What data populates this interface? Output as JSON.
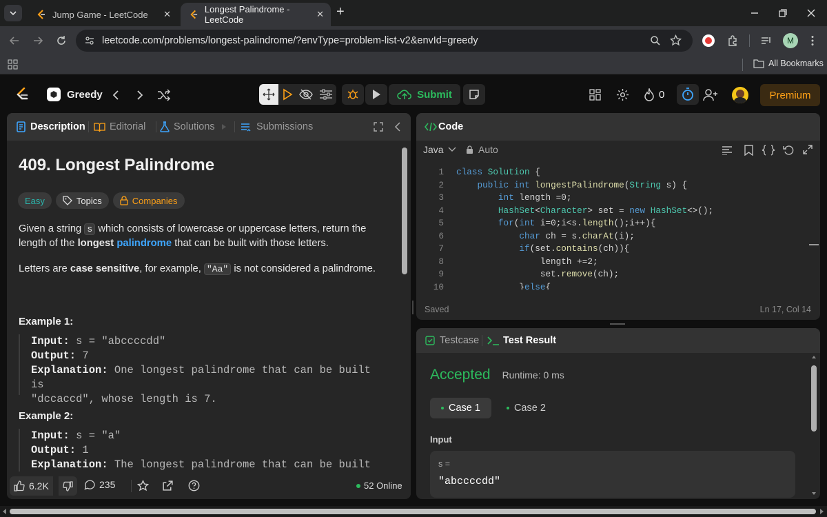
{
  "browser": {
    "tabs": [
      {
        "title": "Jump Game - LeetCode"
      },
      {
        "title": "Longest Palindrome - LeetCode"
      }
    ],
    "url": "leetcode.com/problems/longest-palindrome/?envType=problem-list-v2&envId=greedy",
    "profile_initial": "M",
    "bookmarks_label": "All Bookmarks"
  },
  "nav": {
    "list_name": "Greedy",
    "submit_label": "Submit",
    "streak_count": "0",
    "premium_label": "Premium"
  },
  "left_panel": {
    "tabs": [
      "Description",
      "Editorial",
      "Solutions",
      "Submissions"
    ],
    "problem_title": "409. Longest Palindrome",
    "difficulty": "Easy",
    "topics_label": "Topics",
    "companies_label": "Companies",
    "desc": {
      "p1_a": "Given a string ",
      "p1_code": "s",
      "p1_b": " which consists of lowercase or uppercase letters, return the length of the ",
      "p1_bold": "longest",
      "p1_link": "palindrome",
      "p1_c": " that can be built with those letters.",
      "p2_a": "Letters are ",
      "p2_bold": "case sensitive",
      "p2_b": ", for example, ",
      "p2_code": "\"Aa\"",
      "p2_c": " is not considered a palindrome."
    },
    "examples": [
      {
        "heading": "Example 1:",
        "input_label": "Input:",
        "input": " s = \"abccccdd\"",
        "output_label": "Output:",
        "output": " 7",
        "explanation_label": "Explanation:",
        "explanation": " One longest palindrome that can be built is",
        "explanation_2": "\"dccaccd\", whose length is 7."
      },
      {
        "heading": "Example 2:",
        "input_label": "Input:",
        "input": " s = \"a\"",
        "output_label": "Output:",
        "output": " 1",
        "explanation_label": "Explanation:",
        "explanation": " The longest palindrome that can be built is"
      }
    ],
    "footer": {
      "likes": "6.2K",
      "comments": "235",
      "online": "52 Online"
    }
  },
  "code_panel": {
    "title": "Code",
    "language": "Java",
    "auto_label": "Auto",
    "status": "Saved",
    "cursor": "Ln 17, Col 14",
    "line_numbers": [
      "1",
      "2",
      "3",
      "4",
      "5",
      "6",
      "7",
      "8",
      "9",
      "10"
    ]
  },
  "result_panel": {
    "tab_testcase": "Testcase",
    "tab_result": "Test Result",
    "verdict": "Accepted",
    "runtime": "Runtime: 0 ms",
    "cases": [
      "Case 1",
      "Case 2"
    ],
    "input_heading": "Input",
    "var_label": "s =",
    "var_value": "\"abccccdd\""
  },
  "colors": {
    "accepted": "#2cbb5d",
    "easy": "#2bb4ab",
    "premium": "#ffa116",
    "link": "#3ea6ff",
    "submit": "#2cbb5d"
  }
}
